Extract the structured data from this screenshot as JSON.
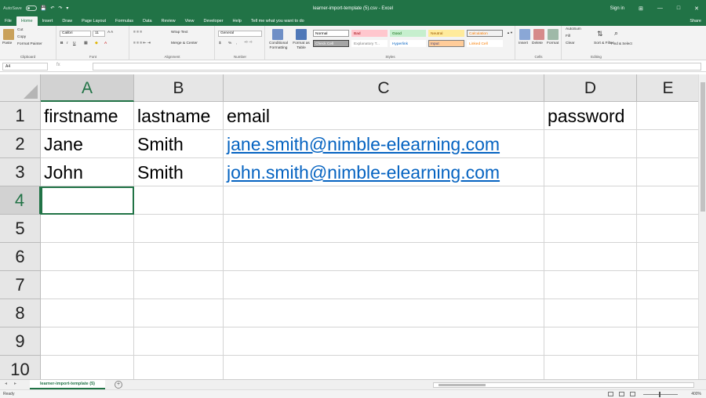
{
  "titlebar": {
    "autosave_label": "AutoSave",
    "autosave_state": "Off",
    "title": "learner-import-template (5).csv - Excel",
    "signin": "Sign in",
    "minimize": "—",
    "restore": "□",
    "close": "✕",
    "ribbon_display": "⊞"
  },
  "tabs": [
    "File",
    "Home",
    "Insert",
    "Draw",
    "Page Layout",
    "Formulas",
    "Data",
    "Review",
    "View",
    "Developer",
    "Help",
    "Tell me what you want to do"
  ],
  "active_tab": "Home",
  "share_label": "Share",
  "ribbon": {
    "clipboard": {
      "label": "Clipboard",
      "paste": "Paste",
      "cut": "Cut",
      "copy": "Copy",
      "format_painter": "Format Painter"
    },
    "font": {
      "label": "Font",
      "family": "Calibri",
      "size": "11",
      "bold": "B",
      "italic": "I",
      "underline": "U"
    },
    "alignment": {
      "label": "Alignment",
      "wrap": "Wrap Text",
      "merge": "Merge & Center"
    },
    "number": {
      "label": "Number",
      "format": "General",
      "percent": "%",
      "comma": ","
    },
    "styles": {
      "label": "Styles",
      "conditional": "Conditional Formatting",
      "format_table": "Format as Table",
      "items": [
        {
          "name": "Normal",
          "bg": "#ffffff",
          "fg": "#000000",
          "border": "#999999"
        },
        {
          "name": "Bad",
          "bg": "#ffc7ce",
          "fg": "#9c0006",
          "border": "#ffc7ce"
        },
        {
          "name": "Good",
          "bg": "#c6efce",
          "fg": "#006100",
          "border": "#c6efce"
        },
        {
          "name": "Neutral",
          "bg": "#ffeb9c",
          "fg": "#9c5700",
          "border": "#ffeb9c"
        },
        {
          "name": "Calculation",
          "bg": "#f2f2f2",
          "fg": "#fa7d00",
          "border": "#7f7f7f"
        },
        {
          "name": "Check Cell",
          "bg": "#a5a5a5",
          "fg": "#ffffff",
          "border": "#3f3f3f"
        },
        {
          "name": "Explanatory T...",
          "bg": "#ffffff",
          "fg": "#7f7f7f",
          "border": "#ffffff"
        },
        {
          "name": "Hyperlink",
          "bg": "#ffffff",
          "fg": "#0563c1",
          "border": "#ffffff"
        },
        {
          "name": "Input",
          "bg": "#ffcc99",
          "fg": "#3f3f76",
          "border": "#7f7f7f"
        },
        {
          "name": "Linked Cell",
          "bg": "#ffffff",
          "fg": "#fa7d00",
          "border": "#ffffff"
        }
      ]
    },
    "cells": {
      "label": "Cells",
      "insert": "Insert",
      "delete": "Delete",
      "format": "Format"
    },
    "editing": {
      "label": "Editing",
      "autosum": "AutoSum",
      "fill": "Fill",
      "clear": "Clear",
      "sort": "Sort & Filter",
      "find": "Find & Select"
    }
  },
  "formula_bar": {
    "name_box": "A4",
    "fx": "fx",
    "value": ""
  },
  "grid": {
    "columns": [
      "A",
      "B",
      "C",
      "D",
      "E"
    ],
    "rows": [
      "1",
      "2",
      "3",
      "4",
      "5",
      "6",
      "7",
      "8",
      "9",
      "10"
    ],
    "cells": [
      [
        "firstname",
        "lastname",
        "email",
        "password",
        ""
      ],
      [
        "Jane",
        "Smith",
        "jane.smith@nimble-elearning.com",
        "",
        ""
      ],
      [
        "John",
        "Smith",
        "john.smith@nimble-elearning.com",
        "",
        ""
      ]
    ],
    "active_cell": "A4",
    "link_color": "#0563c1"
  },
  "sheet_tab": "learner-import-template (5)",
  "add_sheet": "+",
  "status": {
    "ready": "Ready",
    "zoom": "400%"
  },
  "colors": {
    "accent": "#217346"
  }
}
